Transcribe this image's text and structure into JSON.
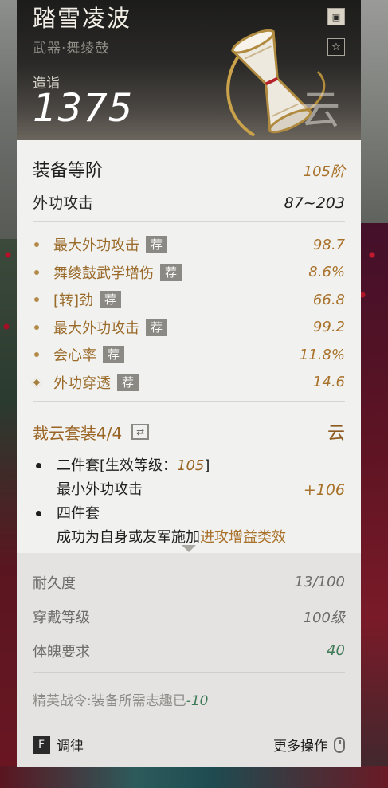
{
  "item": {
    "name": "踏雪凌波",
    "category": "武器·舞绫鼓",
    "forge_label": "造诣",
    "forge_value": "1375",
    "watermark_char": "云"
  },
  "grade": {
    "label": "装备等阶",
    "value": "105阶"
  },
  "attack": {
    "label": "外功攻击",
    "value": "87~203"
  },
  "stats": [
    {
      "name": "最大外功攻击",
      "tag": "荐",
      "value": "98.7",
      "bullet": "dot"
    },
    {
      "name": "舞绫鼓武学增伤",
      "tag": "荐",
      "value": "8.6%",
      "bullet": "dot"
    },
    {
      "name": "[转]劲",
      "tag": "荐",
      "value": "66.8",
      "bullet": "dot"
    },
    {
      "name": "最大外功攻击",
      "tag": "荐",
      "value": "99.2",
      "bullet": "dot"
    },
    {
      "name": "会心率",
      "tag": "荐",
      "value": "11.8%",
      "bullet": "dot"
    },
    {
      "name": "外功穿透",
      "tag": "荐",
      "value": "14.6",
      "bullet": "diamond"
    }
  ],
  "set": {
    "name": "裁云套装4/4",
    "emblem": "云",
    "two_piece": {
      "prefix": "二件套[生效等级：",
      "level": "105",
      "suffix": "]",
      "effect": "最小外功攻击",
      "bonus": "+106"
    },
    "four_piece": {
      "title": "四件套",
      "effect_prefix": "成功为自身或友军施加",
      "effect_highlight": "进攻增益类效"
    }
  },
  "info": [
    {
      "label": "耐久度",
      "value": "13/100",
      "style": "normal"
    },
    {
      "label": "穿戴等级",
      "value": "100级",
      "style": "normal"
    },
    {
      "label": "体魄要求",
      "value": "40",
      "style": "green"
    }
  ],
  "elite": {
    "text": "精英战令:装备所需志趣已",
    "value": "-10"
  },
  "footer": {
    "key": "F",
    "tune_label": "调律",
    "more_label": "更多操作"
  }
}
